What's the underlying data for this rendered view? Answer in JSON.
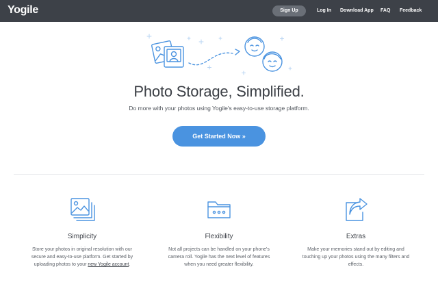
{
  "nav": {
    "logo": "Yogile",
    "signup": "Sign Up",
    "login": "Log In",
    "download": "Download App",
    "faq": "FAQ",
    "feedback": "Feedback"
  },
  "hero": {
    "title": "Photo Storage, Simplified.",
    "subtitle": "Do more with your photos using Yogile's easy-to-use storage platform.",
    "cta": "Get Started Now »"
  },
  "features": [
    {
      "icon": "photos-icon",
      "title": "Simplicity",
      "desc_before": "Store your photos in original resolution with our secure and easy-to-use platform. Get started by uploading photos to your",
      "link": "new Yogile account",
      "desc_after": "."
    },
    {
      "icon": "folder-icon",
      "title": "Flexibility",
      "desc": "Not all projects can be handled on your phone's camera roll. Yogile has the next level of features when you need greater flexibility."
    },
    {
      "icon": "share-icon",
      "title": "Extras",
      "desc": "Make your memories stand out by editing and touching up your photos using the many filters and effects."
    }
  ],
  "colors": {
    "navbar": "#3d4148",
    "accent": "#4a93e0",
    "icon": "#4a93e0"
  }
}
